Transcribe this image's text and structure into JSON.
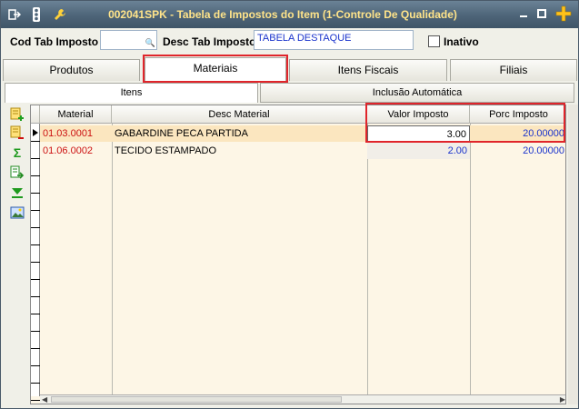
{
  "window": {
    "title": "002041SPK - Tabela de Impostos do Item (1-Controle De Qualidade)",
    "title_color": "#ffe48a",
    "titlebar_color": "#4d6478"
  },
  "header": {
    "cod_label": "Cod Tab Imposto",
    "cod_value": "",
    "desc_label": "Desc Tab Imposto",
    "desc_value": "TABELA DESTAQUE",
    "inativo_label": "Inativo",
    "inativo_checked": false
  },
  "tabs": [
    {
      "label": "Produtos",
      "active": false
    },
    {
      "label": "Materiais",
      "active": true
    },
    {
      "label": "Itens Fiscais",
      "active": false
    },
    {
      "label": "Filiais",
      "active": false
    }
  ],
  "subtabs": [
    {
      "label": "Itens",
      "active": true
    },
    {
      "label": "Inclusão Automática",
      "active": false
    }
  ],
  "toolbar_icons": [
    "add-item-icon",
    "remove-item-icon",
    "sum-icon",
    "export-icon",
    "filter-down-icon",
    "image-icon"
  ],
  "grid": {
    "columns": [
      "Material",
      "Desc Material",
      "Valor Imposto",
      "Porc Imposto"
    ],
    "rows": [
      {
        "material": "01.03.0001",
        "desc": "GABARDINE PECA PARTIDA",
        "valor": "3.00",
        "porc": "20.00000",
        "selected": true
      },
      {
        "material": "01.06.0002",
        "desc": "TECIDO ESTAMPADO",
        "valor": "2.00",
        "porc": "20.00000",
        "selected": false
      }
    ]
  },
  "colors": {
    "material_text": "#cc1111",
    "value_text": "#1a33cc",
    "highlight": "#e0252b",
    "selected_row": "#fbe6bf",
    "grid_bg": "#fdf6e6"
  }
}
